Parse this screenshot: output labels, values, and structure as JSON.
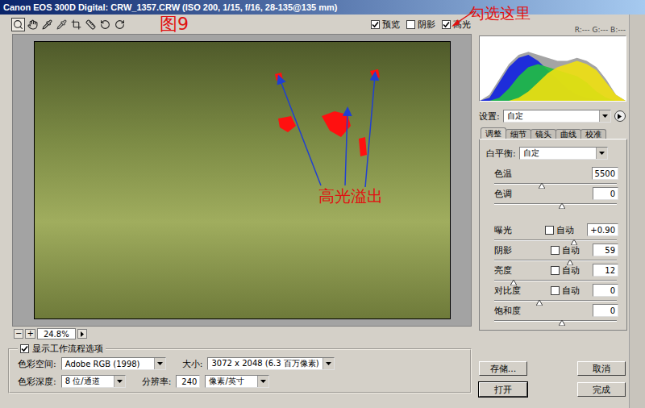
{
  "window": {
    "title": "Canon EOS 300D Digital: CRW_1357.CRW (ISO 200, 1/15, f/16, 28-135@135 mm)"
  },
  "annotations": {
    "figure": "图9",
    "hint": "勾选这里",
    "overflow": "高光溢出"
  },
  "tools": [
    {
      "kind": "zoom",
      "selected": true
    },
    {
      "kind": "hand",
      "selected": false
    },
    {
      "kind": "eyedropper",
      "selected": false
    },
    {
      "kind": "sampler",
      "selected": false
    },
    {
      "kind": "crop",
      "selected": false
    },
    {
      "kind": "straighten",
      "selected": false
    },
    {
      "kind": "rotate-left",
      "selected": false
    },
    {
      "kind": "rotate-right",
      "selected": false
    }
  ],
  "preview_options": [
    {
      "label": "预览",
      "checked": true
    },
    {
      "label": "阴影",
      "checked": false
    },
    {
      "label": "高光",
      "checked": true
    }
  ],
  "readout": "R:---  G:---  B:---",
  "histogram": {
    "series": [
      {
        "name": "all",
        "color": "#9a9a9a",
        "values": [
          0,
          0.1,
          0.35,
          0.6,
          0.75,
          0.8,
          0.75,
          0.7,
          0.65,
          0.65,
          0.7,
          0.65,
          0.55,
          0.35,
          0.1,
          0
        ]
      },
      {
        "name": "blue",
        "color": "#1020e0",
        "values": [
          0,
          0.05,
          0.3,
          0.55,
          0.7,
          0.75,
          0.65,
          0.5,
          0.35,
          0.2,
          0.1,
          0.05,
          0.02,
          0,
          0,
          0
        ]
      },
      {
        "name": "green",
        "color": "#20c040",
        "values": [
          0,
          0,
          0.05,
          0.2,
          0.4,
          0.55,
          0.6,
          0.55,
          0.5,
          0.45,
          0.4,
          0.3,
          0.15,
          0.05,
          0,
          0
        ]
      },
      {
        "name": "yellow",
        "color": "#f0e010",
        "values": [
          0,
          0,
          0,
          0,
          0.05,
          0.15,
          0.3,
          0.45,
          0.55,
          0.6,
          0.65,
          0.6,
          0.5,
          0.3,
          0.1,
          0
        ]
      }
    ]
  },
  "settings": {
    "label": "设置:",
    "value": "自定"
  },
  "tabs": [
    {
      "label": "调整",
      "selected": true
    },
    {
      "label": "细节",
      "selected": false
    },
    {
      "label": "镜头",
      "selected": false
    },
    {
      "label": "曲线",
      "selected": false
    },
    {
      "label": "校准",
      "selected": false
    }
  ],
  "white_balance": {
    "label": "白平衡:",
    "value": "自定"
  },
  "adjustments": [
    {
      "label": "色温",
      "value": "5500",
      "level": 0.39,
      "kind": "plain",
      "group": 1,
      "auto": {
        "label": "",
        "checked": false
      }
    },
    {
      "label": "色调",
      "value": "0",
      "level": 0.55,
      "kind": "plain",
      "group": 1,
      "auto": {
        "label": "",
        "checked": false
      }
    },
    {
      "label": "曝光",
      "value": "+0.90",
      "level": 0.65,
      "kind": "auto",
      "group": 2,
      "auto": {
        "label": "自动",
        "checked": false
      }
    },
    {
      "label": "阴影",
      "value": "59",
      "level": 0.62,
      "kind": "auto",
      "group": 2,
      "auto": {
        "label": "自动",
        "checked": false
      }
    },
    {
      "label": "亮度",
      "value": "12",
      "level": 0.16,
      "kind": "auto",
      "group": 2,
      "auto": {
        "label": "自动",
        "checked": false
      }
    },
    {
      "label": "对比度",
      "value": "0",
      "level": 0.37,
      "kind": "auto",
      "group": 2,
      "auto": {
        "label": "自动",
        "checked": false
      }
    },
    {
      "label": "饱和度",
      "value": "0",
      "level": 0.55,
      "kind": "plain",
      "group": 2,
      "auto": {
        "label": "",
        "checked": false
      }
    }
  ],
  "zoom": {
    "minus": "−",
    "plus": "+",
    "value": "24.8%"
  },
  "workflow": {
    "label": "显示工作流程选项",
    "checked": true,
    "rows": [
      [
        {
          "label": "色彩空间:",
          "value": "Adobe RGB (1998)",
          "kind": "select"
        },
        {
          "label": "大小:",
          "value": "3072 x 2048  (6.3 百万像素)",
          "kind": "select"
        }
      ],
      [
        {
          "label": "色彩深度:",
          "value": "8 位/通道",
          "kind": "select"
        },
        {
          "label": "分辨率:",
          "value": "240",
          "kind": "input"
        },
        {
          "label": "",
          "value": "像素/英寸",
          "kind": "select"
        }
      ]
    ]
  },
  "buttons": [
    {
      "label": "存储...",
      "default": false
    },
    {
      "label": "取消",
      "default": false
    },
    {
      "label": "打开",
      "default": true
    },
    {
      "label": "完成",
      "default": false
    }
  ]
}
